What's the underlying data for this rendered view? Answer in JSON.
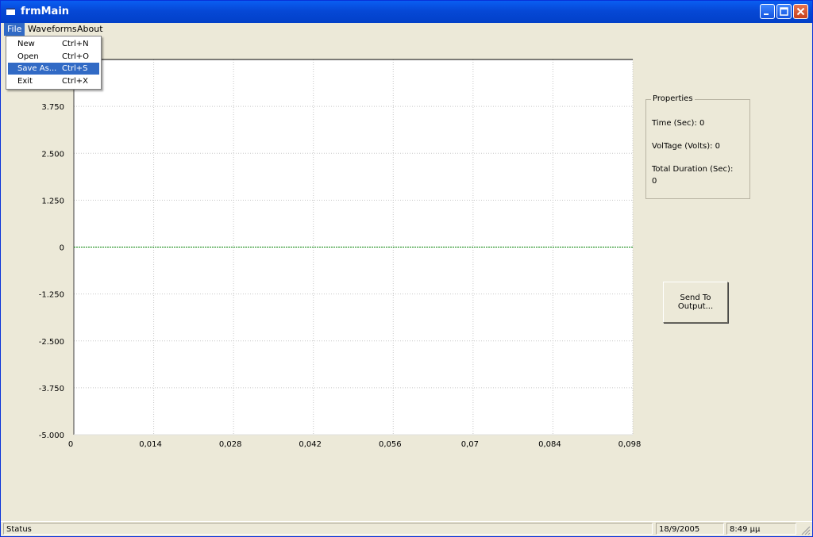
{
  "window": {
    "title": "frmMain",
    "colors": {
      "titlebar": "#0a5ef2",
      "face": "#ece9d8",
      "highlight": "#316ac5"
    }
  },
  "menubar": {
    "items": [
      {
        "label": "File",
        "active": true
      },
      {
        "label": "Waveforms"
      },
      {
        "label": "About"
      }
    ]
  },
  "file_menu": {
    "items": [
      {
        "label": "New",
        "shortcut": "Ctrl+N"
      },
      {
        "label": "Open",
        "shortcut": "Ctrl+O"
      },
      {
        "label": "Save As...",
        "shortcut": "Ctrl+S",
        "highlighted": true
      },
      {
        "label": "Exit",
        "shortcut": "Ctrl+X"
      }
    ]
  },
  "chart_data": {
    "type": "line",
    "title": "",
    "xlabel": "",
    "ylabel": "",
    "x_ticks": [
      "0",
      "0,014",
      "0,028",
      "0,042",
      "0,056",
      "0,07",
      "0,084",
      "0,098"
    ],
    "y_ticks": [
      "3.750",
      "2.500",
      "1.250",
      "0",
      "-1.250",
      "-2.500",
      "-3.750",
      "-5.000"
    ],
    "xlim": [
      0,
      0.098
    ],
    "ylim": [
      -5.0,
      5.0
    ],
    "grid": true,
    "series": [
      {
        "x": [
          0,
          0.098
        ],
        "y": [
          0,
          0
        ],
        "color": "#008000"
      }
    ]
  },
  "properties": {
    "legend": "Properties",
    "time": "Time (Sec): 0",
    "voltage": "VolTage (Volts): 0",
    "duration_label": "Total Duration (Sec):",
    "duration_value": "0"
  },
  "send_button": {
    "line1": "Send To",
    "line2": "Output..."
  },
  "statusbar": {
    "status": "Status",
    "date": "18/9/2005",
    "time": "8:49 μμ"
  }
}
